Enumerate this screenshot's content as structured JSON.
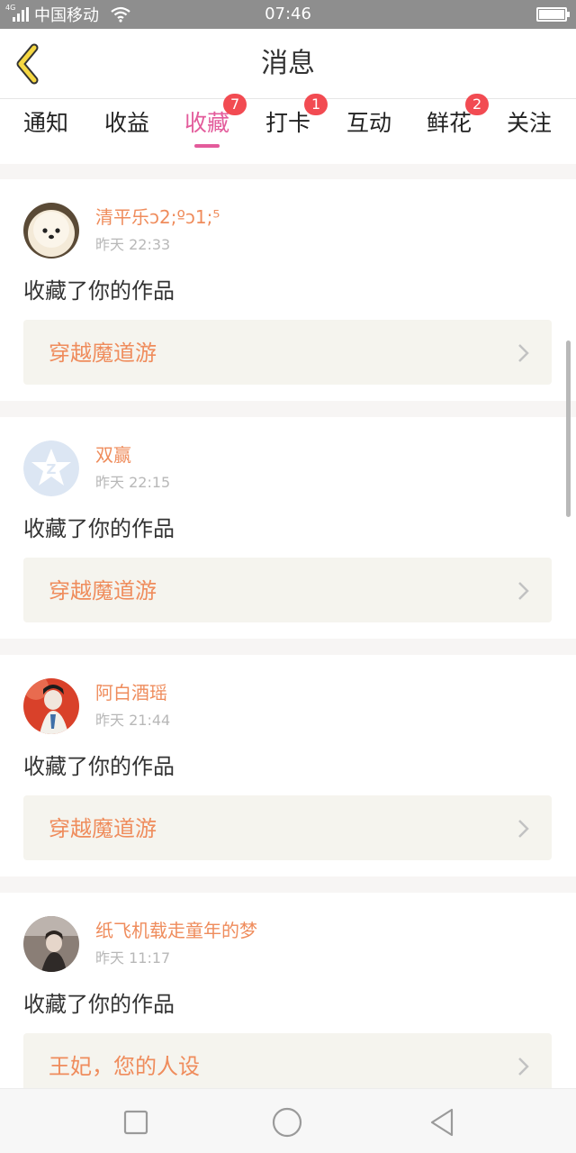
{
  "status_bar": {
    "network": "4G",
    "carrier": "中国移动",
    "time": "07:46"
  },
  "header": {
    "title": "消息",
    "back_icon": "chevron-left-icon"
  },
  "tabs": [
    {
      "label": "通知",
      "badge": "",
      "active": false
    },
    {
      "label": "收益",
      "badge": "",
      "active": false
    },
    {
      "label": "收藏",
      "badge": "7",
      "active": true
    },
    {
      "label": "打卡",
      "badge": "1",
      "active": false
    },
    {
      "label": "互动",
      "badge": "",
      "active": false
    },
    {
      "label": "鲜花",
      "badge": "2",
      "active": false
    },
    {
      "label": "关注",
      "badge": "",
      "active": false
    }
  ],
  "messages": [
    {
      "user": "清平乐ↄ2;ºↄ1;⁵",
      "time": "昨天 22:33",
      "action": "收藏了你的作品",
      "work": "穿越魔道游"
    },
    {
      "user": "双赢",
      "time": "昨天 22:15",
      "action": "收藏了你的作品",
      "work": "穿越魔道游"
    },
    {
      "user": "阿白酒瑶",
      "time": "昨天 21:44",
      "action": "收藏了你的作品",
      "work": "穿越魔道游"
    },
    {
      "user": "纸飞机载走童年的梦",
      "time": "昨天 11:17",
      "action": "收藏了你的作品",
      "work": "王妃，您的人设"
    }
  ],
  "colors": {
    "accent": "#e35b9b",
    "badge": "#f24b52",
    "username": "#ef8c5c",
    "work_link_bg": "#f5f4ee",
    "back_arrow": "#f5d742"
  },
  "system_nav": {
    "icons": [
      "square-icon",
      "circle-icon",
      "triangle-back-icon"
    ]
  }
}
